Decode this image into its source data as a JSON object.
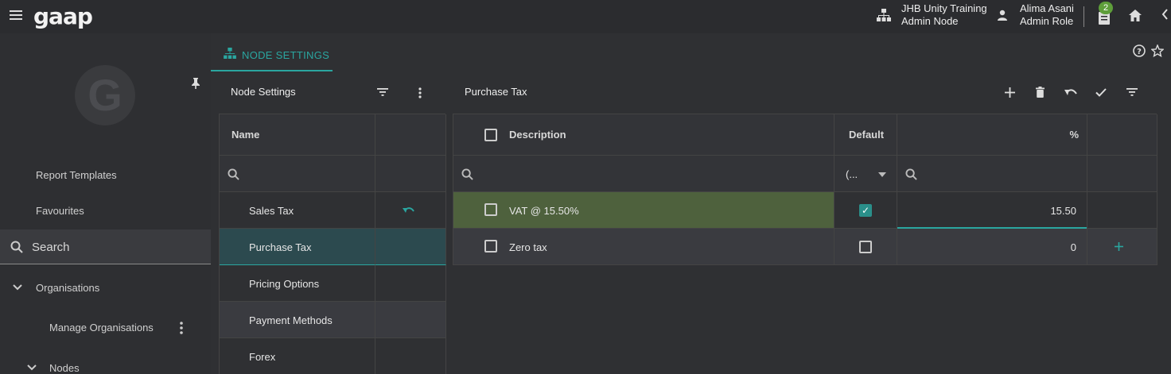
{
  "app": {
    "logo": "gaap"
  },
  "topbar": {
    "node_name": "JHB Unity Training",
    "node_role": "Admin Node",
    "user_name": "Alima Asani",
    "user_role": "Admin Role",
    "notification_count": "2"
  },
  "sidebar": {
    "items": [
      {
        "label": "Report Templates"
      },
      {
        "label": "Favourites"
      }
    ],
    "search_label": "Search",
    "tree": [
      {
        "label": "Organisations"
      },
      {
        "label": "Manage Organisations"
      },
      {
        "label": "Nodes"
      }
    ]
  },
  "tab": {
    "label": "NODE SETTINGS"
  },
  "left_panel": {
    "title": "Node Settings",
    "column_name": "Name",
    "rows": [
      {
        "label": "Sales Tax"
      },
      {
        "label": "Purchase Tax"
      },
      {
        "label": "Pricing Options"
      },
      {
        "label": "Payment Methods"
      },
      {
        "label": "Forex"
      }
    ]
  },
  "right_panel": {
    "title": "Purchase Tax",
    "columns": {
      "description": "Description",
      "default": "Default",
      "percent": "%"
    },
    "default_filter": "(...",
    "rows": [
      {
        "description": "VAT @ 15.50%",
        "default": true,
        "percent": "15.50"
      },
      {
        "description": "Zero tax",
        "default": false,
        "percent": "0"
      }
    ]
  },
  "colors": {
    "accent": "#2aa6a0",
    "edit_row": "#4e613d",
    "badge": "#5e9e3a"
  }
}
